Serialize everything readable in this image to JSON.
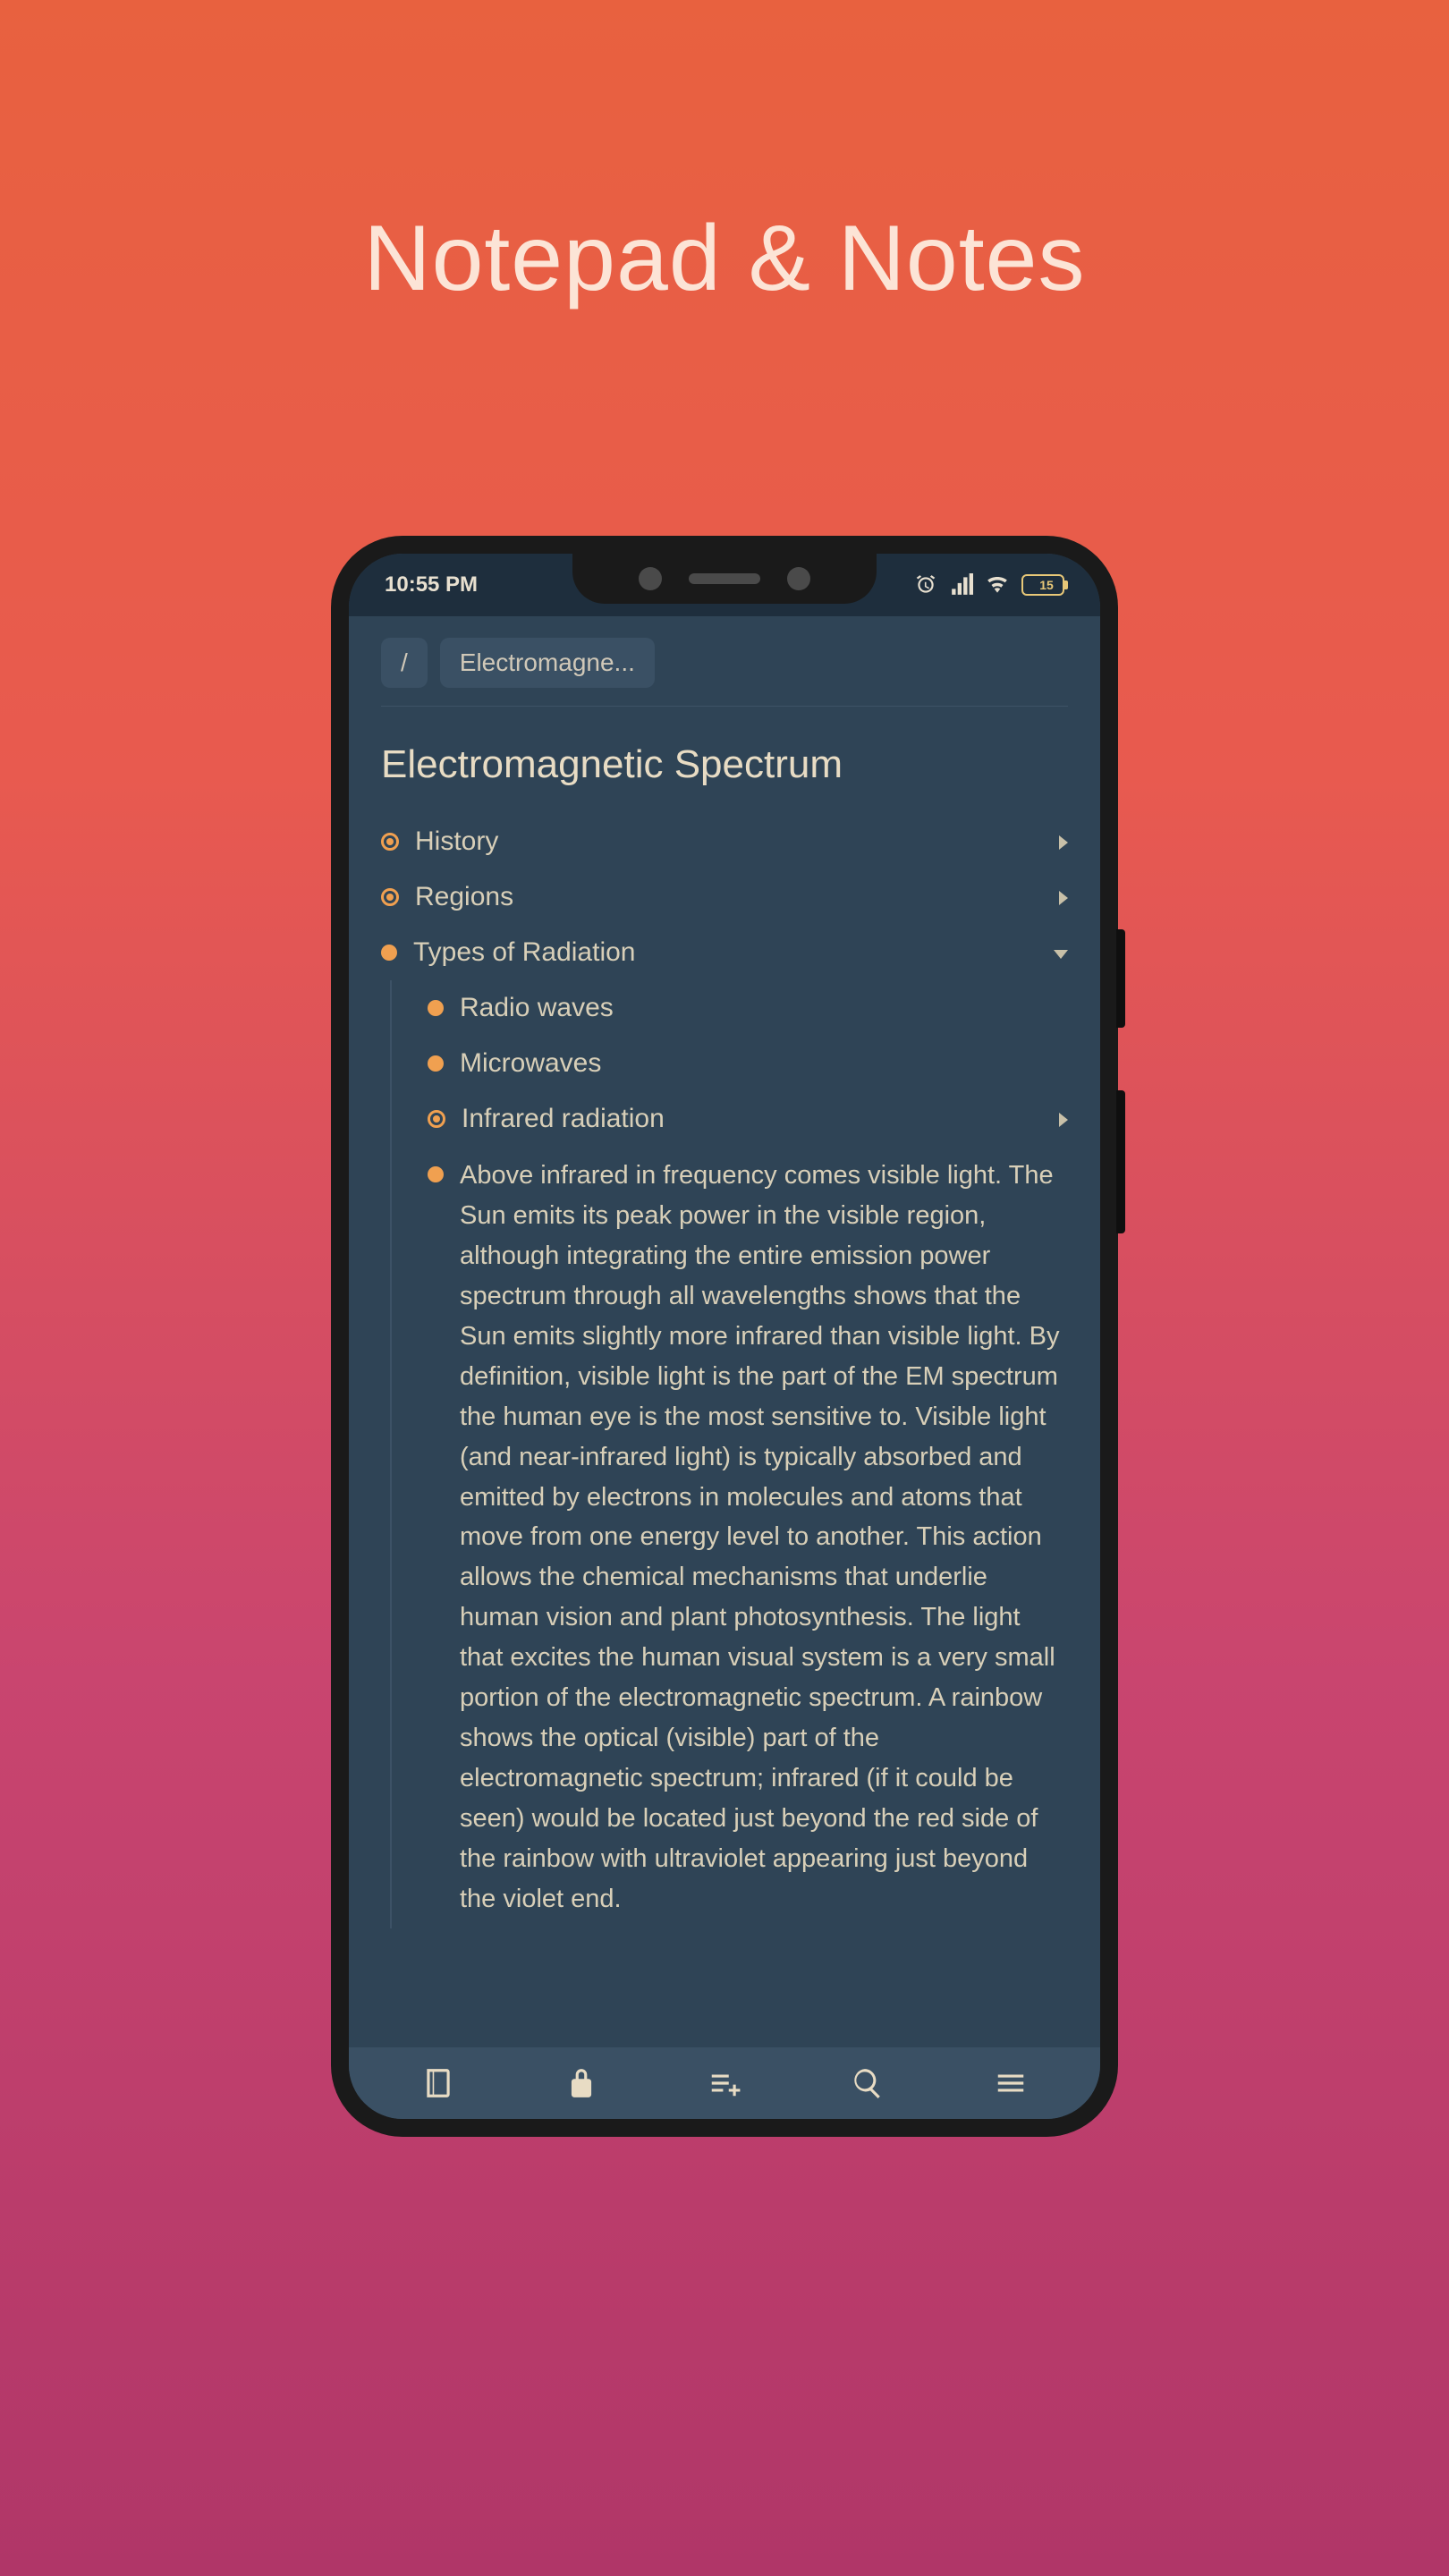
{
  "hero": {
    "title": "Notepad & Notes"
  },
  "statusBar": {
    "time": "10:55 PM",
    "battery": "15"
  },
  "breadcrumb": {
    "root": "/",
    "current": "Electromagne..."
  },
  "note": {
    "title": "Electromagnetic Spectrum"
  },
  "outline": {
    "history": "History",
    "regions": "Regions",
    "types": "Types of Radiation",
    "radio": "Radio waves",
    "microwaves": "Microwaves",
    "infrared": "Infrared radiation",
    "visible_para": "Above infrared in frequency comes visible light. The Sun emits its peak power in the visible region, although integrating the entire emission power spectrum through all wavelengths shows that the Sun emits slightly more infrared than visible light. By definition, visible light is the part of the EM spectrum the human eye is the most sensitive to. Visible light (and near-infrared light) is typically absorbed and emitted by electrons in molecules and atoms that move from one energy level to another. This action allows the chemical mechanisms that underlie human vision and plant photosynthesis. The light that excites the human visual system is a very small portion of the electromagnetic spectrum. A rainbow shows the optical (visible) part of the electromagnetic spectrum; infrared (if it could be seen) would be located just beyond the red side of the rainbow with ultraviolet appearing just beyond the violet end."
  }
}
